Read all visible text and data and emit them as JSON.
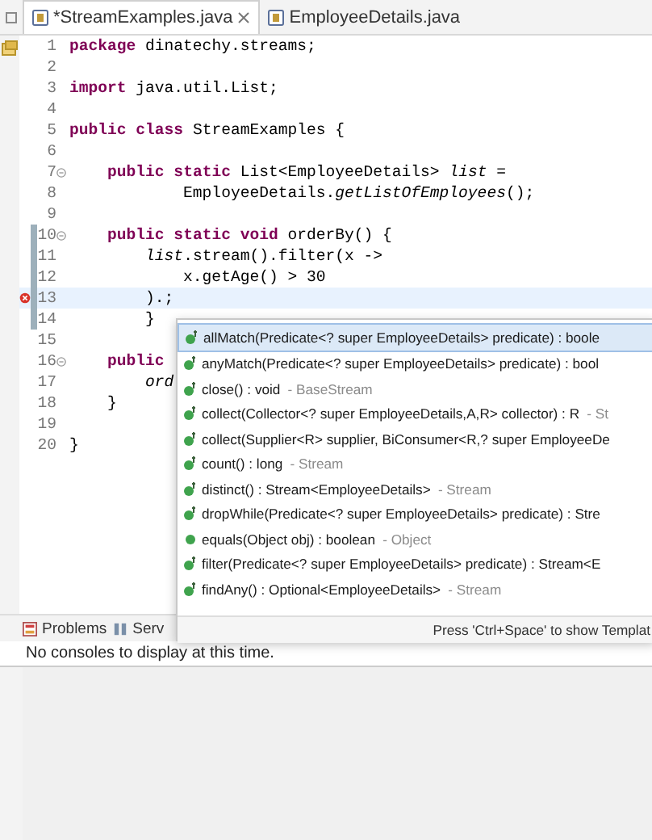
{
  "tabs": [
    {
      "label": "*StreamExamples.java",
      "selected": true,
      "closable": true
    },
    {
      "label": "EmployeeDetails.java",
      "selected": false,
      "closable": false
    }
  ],
  "editor": {
    "lines": [
      {
        "number": "1",
        "fold": false,
        "changed": false,
        "error": false,
        "current": false,
        "code": "**package** dinatechy.streams;"
      },
      {
        "number": "2",
        "fold": false,
        "changed": false,
        "error": false,
        "current": false
      },
      {
        "number": "3",
        "fold": false,
        "changed": false,
        "error": false,
        "current": false,
        "code": "**import** java.util.List;"
      },
      {
        "number": "4",
        "fold": false,
        "changed": false,
        "error": false,
        "current": false
      },
      {
        "number": "5",
        "fold": false,
        "changed": false,
        "error": false,
        "current": false,
        "code": "**public class** StreamExamples {"
      },
      {
        "number": "6",
        "fold": false,
        "changed": false,
        "error": false,
        "current": false
      },
      {
        "number": "7",
        "fold": true,
        "changed": false,
        "error": false,
        "current": false,
        "code": "    **public static** List<EmployeeDetails> *list* ="
      },
      {
        "number": "8",
        "fold": false,
        "changed": false,
        "error": false,
        "current": false,
        "code": "            EmployeeDetails.*getListOfEmployees*();"
      },
      {
        "number": "9",
        "fold": false,
        "changed": false,
        "error": false,
        "current": false
      },
      {
        "number": "10",
        "fold": true,
        "changed": true,
        "error": false,
        "current": false,
        "code": "    **public static void** orderBy() {"
      },
      {
        "number": "11",
        "fold": false,
        "changed": true,
        "error": false,
        "current": false,
        "code": "        *list*.stream().filter(x ->"
      },
      {
        "number": "12",
        "fold": false,
        "changed": true,
        "error": false,
        "current": false,
        "code": "            x.getAge() > 30"
      },
      {
        "number": "13",
        "fold": false,
        "changed": true,
        "error": true,
        "current": true,
        "code": "        ).;"
      },
      {
        "number": "14",
        "fold": false,
        "changed": true,
        "error": false,
        "current": false,
        "code": "        }"
      },
      {
        "number": "15",
        "fold": false,
        "changed": false,
        "error": false,
        "current": false
      },
      {
        "number": "16",
        "fold": true,
        "changed": false,
        "error": false,
        "current": false,
        "code": "    **public**"
      },
      {
        "number": "17",
        "fold": false,
        "changed": false,
        "error": false,
        "current": false,
        "code": "        *ord*"
      },
      {
        "number": "18",
        "fold": false,
        "changed": false,
        "error": false,
        "current": false,
        "code": "    }"
      },
      {
        "number": "19",
        "fold": false,
        "changed": false,
        "error": false,
        "current": false
      },
      {
        "number": "20",
        "fold": false,
        "changed": false,
        "error": false,
        "current": false,
        "code": "}"
      }
    ]
  },
  "completion": {
    "items": [
      {
        "signature": "allMatch(Predicate<? super EmployeeDetails> predicate) : boole",
        "kind": "default",
        "selected": true
      },
      {
        "signature": "anyMatch(Predicate<? super EmployeeDetails> predicate) : bool",
        "kind": "default",
        "selected": false
      },
      {
        "signature": "close() : void",
        "source": "- BaseStream",
        "kind": "default",
        "selected": false
      },
      {
        "signature": "collect(Collector<? super EmployeeDetails,A,R> collector) : R",
        "source": "- St",
        "kind": "default",
        "selected": false
      },
      {
        "signature": "collect(Supplier<R> supplier, BiConsumer<R,? super EmployeeDe",
        "kind": "default",
        "selected": false
      },
      {
        "signature": "count() : long",
        "source": "- Stream",
        "kind": "default",
        "selected": false
      },
      {
        "signature": "distinct() : Stream<EmployeeDetails>",
        "source": "- Stream",
        "kind": "default",
        "selected": false
      },
      {
        "signature": "dropWhile(Predicate<? super EmployeeDetails> predicate) : Stre",
        "kind": "default",
        "selected": false
      },
      {
        "signature": "equals(Object obj) : boolean",
        "source": "- Object",
        "kind": "public",
        "selected": false
      },
      {
        "signature": "filter(Predicate<? super EmployeeDetails> predicate) : Stream<E",
        "kind": "default",
        "selected": false
      },
      {
        "signature": "findAny() : Optional<EmployeeDetails>",
        "source": "- Stream",
        "kind": "default",
        "selected": false
      }
    ],
    "hint": "Press 'Ctrl+Space' to show Templat"
  },
  "console": {
    "tabs": [
      {
        "label": "Problems",
        "kind": "problems"
      },
      {
        "label": "Serv",
        "kind": "servers"
      }
    ],
    "message": "No consoles to display at this time."
  }
}
